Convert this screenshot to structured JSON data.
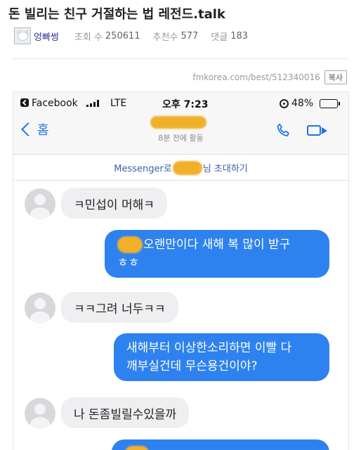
{
  "post": {
    "title": "돈 빌리는 친구 거절하는 법 레전드.talk",
    "author": "엉빠썽",
    "views_label": "조회 수",
    "views": "250611",
    "likes_label": "추천수",
    "likes": "577",
    "comments_label": "댓글",
    "comments": "183",
    "source_url": "fmkorea.com/best/512340016",
    "copy_label": "복사"
  },
  "screenshot": {
    "status": {
      "app": "Facebook",
      "network": "LTE",
      "time": "오후 7:23",
      "battery": "48%",
      "battery_level": 0.48
    },
    "nav": {
      "back_label": "홈",
      "active_status": "8분 전에 활동"
    },
    "invite": {
      "prefix": "Messenger로",
      "suffix": "님 초대하기"
    },
    "messages": [
      {
        "side": "in",
        "text": "ㅋ민섭이 머해ㅋ"
      },
      {
        "side": "out",
        "line1": "오랜만이다 새해 복 많이 받구",
        "line2": "ㅎㅎ"
      },
      {
        "side": "in",
        "text": "ㅋㅋ그려 너두ㅋㅋ"
      },
      {
        "side": "out",
        "line1": "새해부터 이상한소리하면 이빨 다",
        "line2": "깨부실건데 무슨용건이야?"
      },
      {
        "side": "in",
        "text": "나 돈좀빌릴수있을까"
      }
    ]
  },
  "colors": {
    "messenger_blue": "#2e82ef",
    "incoming_bubble": "#efeff2",
    "link_blue": "#1a73e8",
    "redaction": "#f2b02a"
  }
}
